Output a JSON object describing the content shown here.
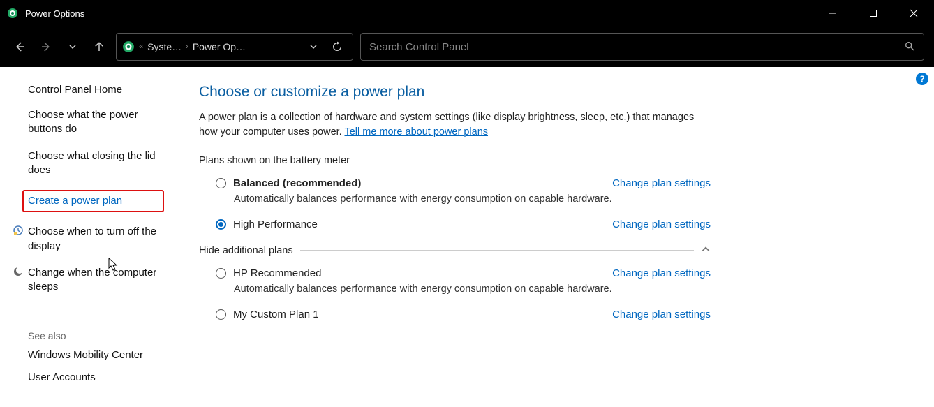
{
  "window": {
    "title": "Power Options"
  },
  "breadcrumb": {
    "crumb1": "Syste…",
    "crumb2": "Power Op…"
  },
  "search": {
    "placeholder": "Search Control Panel"
  },
  "sidebar": {
    "home": "Control Panel Home",
    "links": [
      "Choose what the power buttons do",
      "Choose what closing the lid does",
      "Create a power plan",
      "Choose when to turn off the display",
      "Change when the computer sleeps"
    ],
    "see_also_header": "See also",
    "see_also": [
      "Windows Mobility Center",
      "User Accounts"
    ]
  },
  "main": {
    "title": "Choose or customize a power plan",
    "desc_prefix": "A power plan is a collection of hardware and system settings (like display brightness, sleep, etc.) that manages how your computer uses power. ",
    "desc_link": "Tell me more about power plans",
    "section1_label": "Plans shown on the battery meter",
    "plans": [
      {
        "name": "Balanced (recommended)",
        "bold": true,
        "selected": false,
        "desc": "Automatically balances performance with energy consumption on capable hardware.",
        "link": "Change plan settings"
      },
      {
        "name": "High Performance",
        "bold": false,
        "selected": true,
        "desc": "",
        "link": "Change plan settings"
      }
    ],
    "hide_label": "Hide additional plans",
    "hidden_plans": [
      {
        "name": "HP Recommended",
        "bold": false,
        "selected": false,
        "desc": "Automatically balances performance with energy consumption on capable hardware.",
        "link": "Change plan settings"
      },
      {
        "name": "My Custom Plan 1",
        "bold": false,
        "selected": false,
        "desc": "",
        "link": "Change plan settings"
      }
    ]
  },
  "help_badge": "?"
}
